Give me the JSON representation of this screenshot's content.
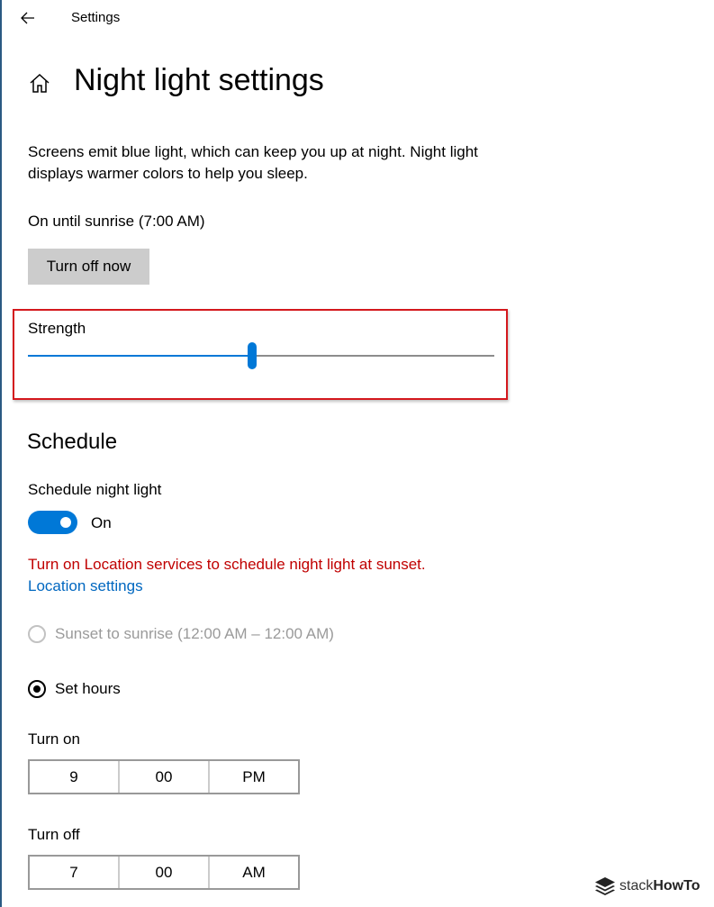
{
  "app": {
    "title": "Settings"
  },
  "page": {
    "title": "Night light settings",
    "description": "Screens emit blue light, which can keep you up at night. Night light displays warmer colors to help you sleep.",
    "status": "On until sunrise (7:00 AM)",
    "turn_off_label": "Turn off now"
  },
  "strength": {
    "label": "Strength",
    "value_percent": 48
  },
  "schedule": {
    "title": "Schedule",
    "toggle_label": "Schedule night light",
    "toggle_state": "On",
    "warning": "Turn on Location services to schedule night light at sunset.",
    "link_label": "Location settings",
    "option_sunset": "Sunset to sunrise (12:00 AM – 12:00 AM)",
    "option_hours": "Set hours",
    "selected_option": "option_hours",
    "turn_on": {
      "label": "Turn on",
      "hour": "9",
      "minute": "00",
      "period": "PM"
    },
    "turn_off": {
      "label": "Turn off",
      "hour": "7",
      "minute": "00",
      "period": "AM"
    }
  },
  "watermark": {
    "prefix": "stack",
    "suffix": "HowTo"
  },
  "colors": {
    "accent": "#0078d7",
    "warning": "#c00000",
    "link": "#0067c0",
    "highlight": "#d4181d"
  }
}
